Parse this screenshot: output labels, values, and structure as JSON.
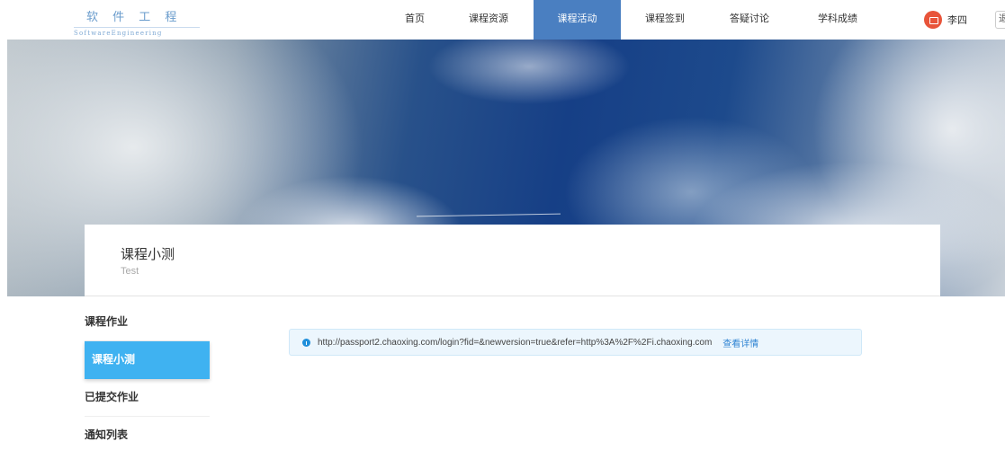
{
  "header": {
    "logo_cn": "软 件 工 程",
    "logo_en": "SoftwareEngineering",
    "nav": [
      {
        "label": "首页"
      },
      {
        "label": "课程资源"
      },
      {
        "label": "课程活动"
      },
      {
        "label": "课程签到"
      },
      {
        "label": "答疑讨论"
      },
      {
        "label": "学科成绩"
      }
    ],
    "active_nav_index": 2,
    "user_name": "李四",
    "edge_text": "退"
  },
  "page": {
    "title": "课程小测",
    "subtitle": "Test"
  },
  "sidebar": {
    "items": [
      {
        "label": "课程作业"
      },
      {
        "label": "课程小测"
      },
      {
        "label": "已提交作业"
      },
      {
        "label": "通知列表"
      }
    ],
    "active_index": 1
  },
  "alert": {
    "url": "http://passport2.chaoxing.com/login?fid=&newversion=true&refer=http%3A%2F%2Fi.chaoxing.com",
    "link_label": "查看详情"
  },
  "colors": {
    "nav_active": "#4a7fc1",
    "sidebar_active": "#3fb2f1",
    "alert_bg": "#ecf6fd",
    "link": "#2f84d3"
  }
}
